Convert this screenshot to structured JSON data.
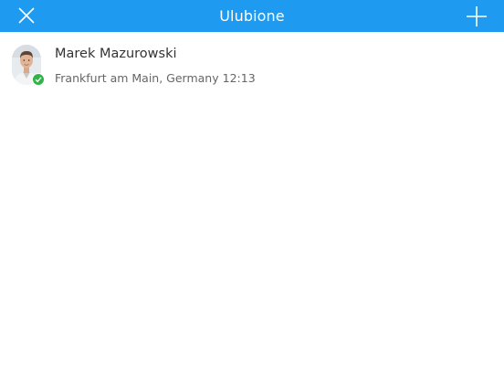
{
  "navbar": {
    "title": "Ulubione",
    "close_icon": "close-icon",
    "add_icon": "plus-icon",
    "background_color": "#1e9bf0"
  },
  "contacts": [
    {
      "name": "Marek Mazurowski",
      "location": "Frankfurt am Main, Germany",
      "time": "12:13",
      "status": "online",
      "status_color": "#2fb34a",
      "avatar_icon": "avatar-photo"
    }
  ]
}
